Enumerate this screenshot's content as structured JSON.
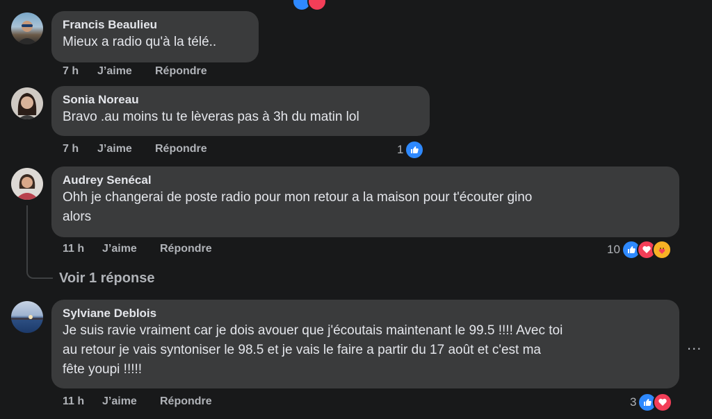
{
  "comments": [
    {
      "author": "Francis Beaulieu",
      "text": "Mieux a radio qu'à la télé..",
      "time": "7 h",
      "like_label": "J’aime",
      "reply_label": "Répondre"
    },
    {
      "author": "Sonia Noreau",
      "text": "Bravo .au moins tu te lèveras pas à 3h du matin lol",
      "time": "7 h",
      "like_label": "J’aime",
      "reply_label": "Répondre",
      "reaction_count": "1",
      "reactions": [
        "like"
      ]
    },
    {
      "author": "Audrey Senécal",
      "text_line1": "Ohh je changerai de poste radio pour mon retour a la maison pour t'écouter gino",
      "text_line2": "alors",
      "time": "11 h",
      "like_label": "J’aime",
      "reply_label": "Répondre",
      "reaction_count": "10",
      "reactions": [
        "like",
        "love",
        "care"
      ],
      "replies_link": "Voir 1 réponse"
    },
    {
      "author": "Sylviane Deblois",
      "text_line1": "Je suis ravie vraiment car je dois avouer que j'écoutais maintenant le 99.5 !!!! Avec toi",
      "text_line2": "au retour je vais syntoniser le 98.5 et je vais le faire a partir du 17 août et c'est ma",
      "text_line3": "fête youpi !!!!!",
      "time": "11 h",
      "like_label": "J’aime",
      "reply_label": "Répondre",
      "reaction_count": "3",
      "reactions": [
        "like",
        "love"
      ]
    }
  ],
  "more_options": "...",
  "colors": {
    "background": "#18191a",
    "bubble": "#3a3b3c",
    "text": "#e4e6eb",
    "muted": "#b0b3b8",
    "like": "#2e89ff",
    "love": "#f33e58",
    "care": "#f7b125"
  }
}
